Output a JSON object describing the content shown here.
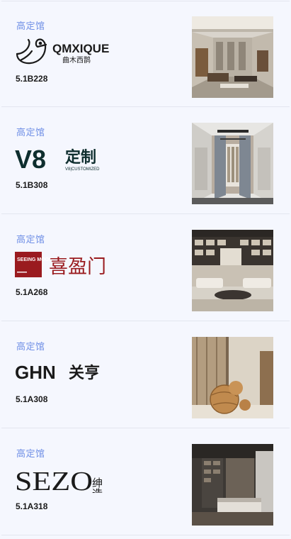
{
  "stores": [
    {
      "category": "高定馆",
      "brand": "QMXIQUE",
      "brand_sub": "曲木西鹊",
      "booth": "5.1B228",
      "logo_icon": "bird-icon",
      "logo_color": "#1a1a1a"
    },
    {
      "category": "高定馆",
      "brand": "V8",
      "brand_cn": "定制",
      "brand_sub": "V8|CUSTOMIZED",
      "booth": "5.1B308",
      "logo_color": "#0e2e2e"
    },
    {
      "category": "高定馆",
      "brand_badge": "SEEING MOON",
      "brand_cn": "喜盈门",
      "booth": "5.1A268",
      "logo_color": "#9a1b1f"
    },
    {
      "category": "高定馆",
      "brand": "GHN",
      "brand_cn": "关亨",
      "booth": "5.1A308",
      "logo_color": "#1a1a1a"
    },
    {
      "category": "高定馆",
      "brand": "SEZO",
      "brand_cn": "绅造",
      "booth": "5.1A318",
      "logo_color": "#1a1a1a"
    }
  ]
}
